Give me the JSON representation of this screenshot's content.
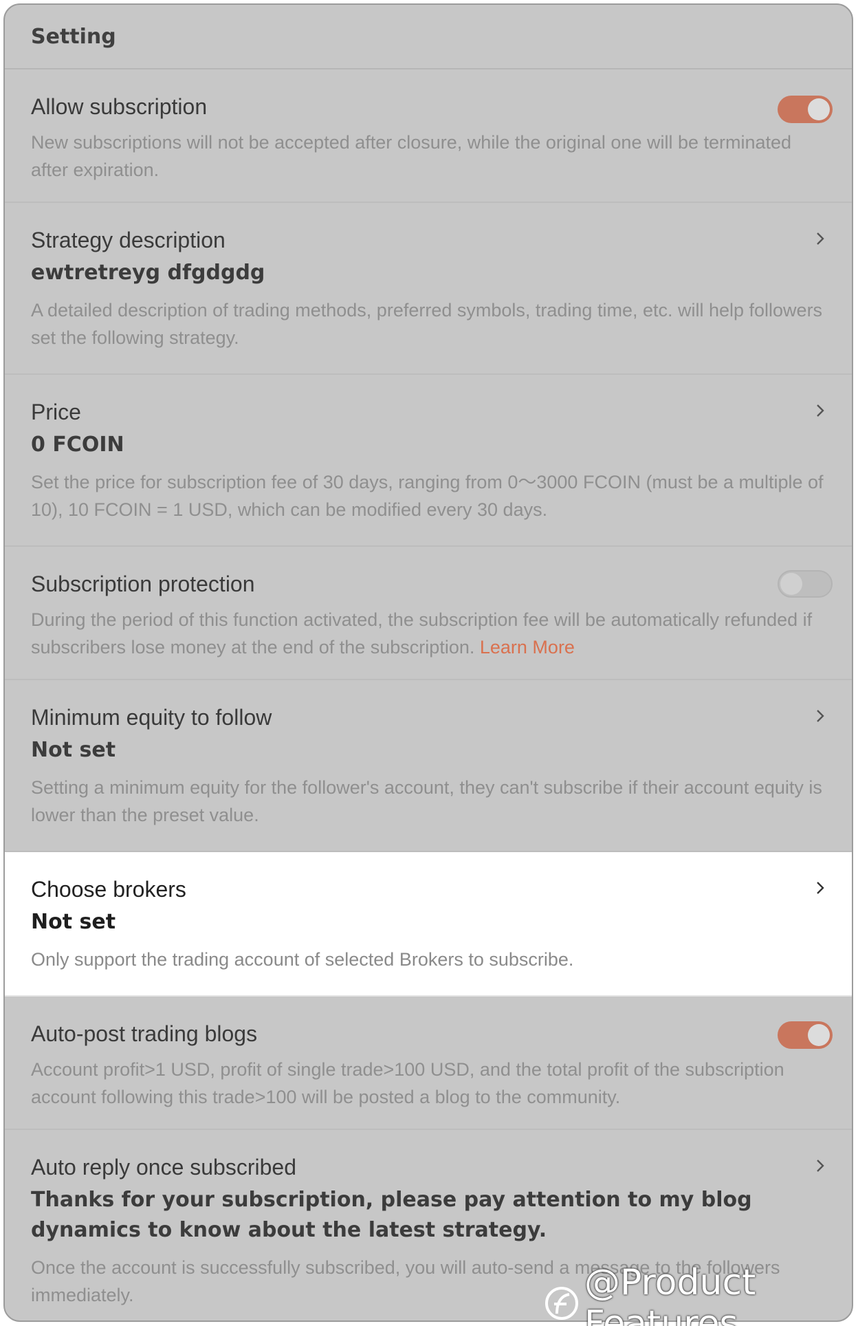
{
  "header": {
    "title": "Setting"
  },
  "rows": [
    {
      "title": "Allow subscription",
      "desc": "New subscriptions will not be accepted after closure, while the original one will be terminated after expiration.",
      "toggle": "on"
    },
    {
      "title": "Strategy description",
      "value": "ewtretreyg dfgdgdg",
      "desc": "A detailed description of trading methods, preferred symbols, trading time, etc. will help followers set the following strategy."
    },
    {
      "title": "Price",
      "value": "0 FCOIN",
      "desc": "Set the price for subscription fee of 30 days, ranging from 0～3000 FCOIN (must be a multiple of 10), 10 FCOIN = 1 USD, which can be modified every 30 days."
    },
    {
      "title": "Subscription protection",
      "desc": "During the period of this function activated, the subscription fee will be automatically refunded if subscribers lose money at the end of the subscription.",
      "link": "Learn More",
      "toggle": "off"
    },
    {
      "title": "Minimum equity to follow",
      "value": "Not set",
      "desc": "Setting a minimum equity for the follower's account, they can't subscribe if their account equity is lower than the preset value."
    },
    {
      "title": "Choose brokers",
      "value": "Not set",
      "desc": "Only support the trading account of selected Brokers to subscribe.",
      "highlighted": true
    },
    {
      "title": "Auto-post trading blogs",
      "desc": "Account profit>1 USD, profit of single trade>100 USD, and the total profit of the subscription account following this trade>100 will be posted a blog to the community.",
      "toggle": "on"
    },
    {
      "title": "Auto reply once subscribed",
      "value": "Thanks for your subscription, please pay attention to my blog dynamics to know about the latest strategy.",
      "desc": "Once the account is successfully subscribed, you will auto-send a message to the followers immediately."
    }
  ],
  "watermark": {
    "text": "@Product Features"
  },
  "colors": {
    "accent": "#d9714f",
    "toggle_on": "#c9765d",
    "overlay": "#c7c7c7"
  }
}
